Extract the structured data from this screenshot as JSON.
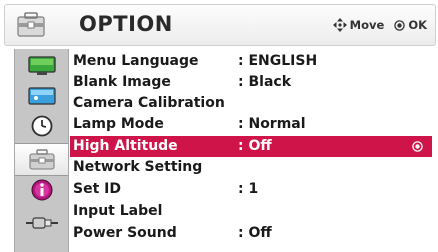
{
  "header": {
    "title": "OPTION",
    "icon": "toolbox-icon",
    "move_hint": "Move",
    "ok_hint": "OK"
  },
  "sidebar": {
    "items": [
      {
        "icon": "monitor-icon"
      },
      {
        "icon": "image-icon"
      },
      {
        "icon": "clock-icon"
      },
      {
        "icon": "toolbox-icon",
        "active": true
      },
      {
        "icon": "info-icon"
      },
      {
        "icon": "input-plug-icon"
      }
    ]
  },
  "menu": {
    "items": [
      {
        "label": "Menu Language",
        "value": ": ENGLISH"
      },
      {
        "label": "Blank Image",
        "value": ": Black"
      },
      {
        "label": "Camera Calibration",
        "value": ""
      },
      {
        "label": "Lamp Mode",
        "value": ": Normal"
      },
      {
        "label": "High Altitude",
        "value": ": Off",
        "selected": true
      },
      {
        "label": "Network Setting",
        "value": ""
      },
      {
        "label": "Set ID",
        "value": ": 1"
      },
      {
        "label": "Input Label",
        "value": ""
      },
      {
        "label": "Power Sound",
        "value": ": Off"
      }
    ]
  },
  "colors": {
    "highlight": "#cf1449",
    "sidebar": "#c6c6c6",
    "header": "#ececec"
  }
}
